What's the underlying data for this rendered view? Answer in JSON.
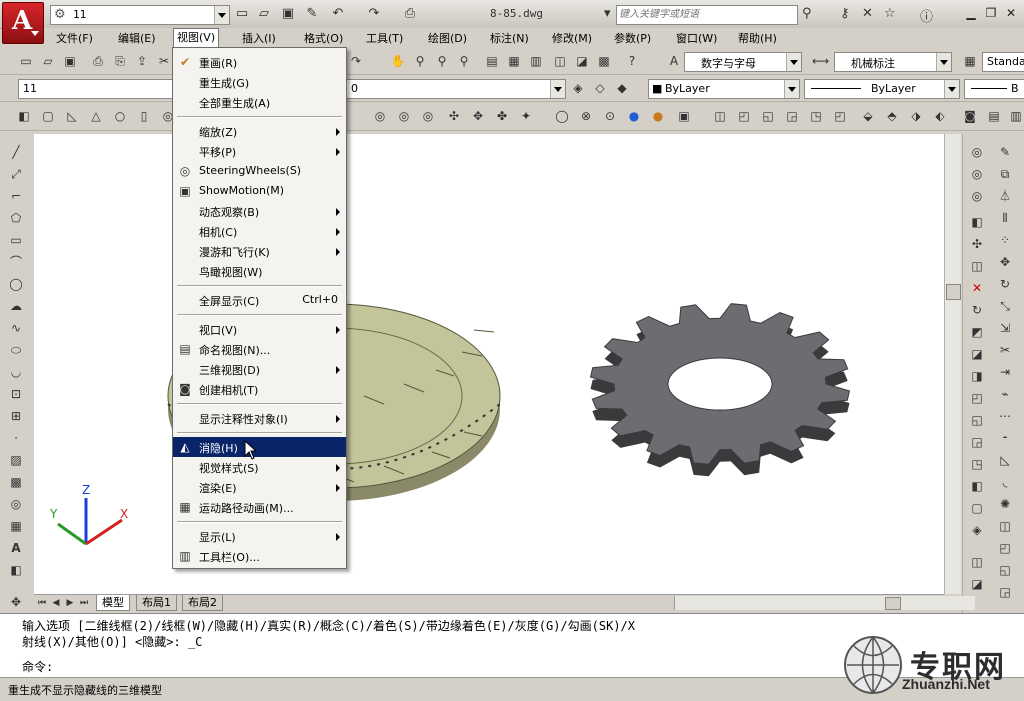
{
  "window": {
    "workspace_value": "11",
    "doc_title": "8-85.dwg",
    "search_placeholder": "键入关键字或短语"
  },
  "menubar": {
    "items": [
      {
        "label": "文件(F)"
      },
      {
        "label": "编辑(E)"
      },
      {
        "label": "视图(V)"
      },
      {
        "label": "插入(I)"
      },
      {
        "label": "格式(O)"
      },
      {
        "label": "工具(T)"
      },
      {
        "label": "绘图(D)"
      },
      {
        "label": "标注(N)"
      },
      {
        "label": "修改(M)"
      },
      {
        "label": "参数(P)"
      },
      {
        "label": "窗口(W)"
      },
      {
        "label": "帮助(H)"
      }
    ]
  },
  "toolbar": {
    "text_style": "数字与字母",
    "dim_style": "机械标注",
    "table_style": "Standa",
    "layer": "11",
    "layer_state": "0",
    "color": "ByLayer",
    "linetype": "ByLayer",
    "lineweight": "B"
  },
  "view_menu": {
    "items": [
      {
        "label": "重画(R)",
        "icon": "brush-icon"
      },
      {
        "label": "重生成(G)"
      },
      {
        "label": "全部重生成(A)"
      },
      {
        "label": "缩放(Z)",
        "submenu": true
      },
      {
        "label": "平移(P)",
        "submenu": true
      },
      {
        "label": "SteeringWheels(S)",
        "icon": "steering-wheel-icon"
      },
      {
        "label": "ShowMotion(M)",
        "icon": "showmotion-icon"
      },
      {
        "label": "动态观察(B)",
        "submenu": true
      },
      {
        "label": "相机(C)",
        "submenu": true
      },
      {
        "label": "漫游和飞行(K)",
        "submenu": true
      },
      {
        "label": "鸟瞰视图(W)"
      },
      {
        "label": "全屏显示(C)",
        "shortcut": "Ctrl+0"
      },
      {
        "label": "视口(V)",
        "submenu": true
      },
      {
        "label": "命名视图(N)...",
        "icon": "named-view-icon"
      },
      {
        "label": "三维视图(D)",
        "submenu": true
      },
      {
        "label": "创建相机(T)",
        "icon": "camera-icon"
      },
      {
        "label": "显示注释性对象(I)",
        "submenu": true
      },
      {
        "label": "消隐(H)",
        "icon": "hide-icon",
        "highlighted": true
      },
      {
        "label": "视觉样式(S)",
        "submenu": true
      },
      {
        "label": "渲染(E)",
        "submenu": true
      },
      {
        "label": "运动路径动画(M)...",
        "icon": "motion-path-icon"
      },
      {
        "label": "显示(L)",
        "submenu": true
      },
      {
        "label": "工具栏(O)...",
        "icon": "toolbar-icon"
      }
    ]
  },
  "ucs": {
    "x": "X",
    "y": "Y",
    "z": "Z"
  },
  "tabs": [
    {
      "label": "模型"
    },
    {
      "label": "布局1"
    },
    {
      "label": "布局2"
    }
  ],
  "command": {
    "line1": "输入选项 [二维线框(2)/线框(W)/隐藏(H)/真实(R)/概念(C)/着色(S)/带边缘着色(E)/灰度(G)/勾画(SK)/X",
    "line2": "射线(X)/其他(O)] <隐藏>: _C",
    "prompt": "命令:"
  },
  "status": {
    "text": "重生成不显示隐藏线的三维模型"
  },
  "watermark": {
    "text": "专职网",
    "url": "Zhuanzhi.Net"
  },
  "colors": {
    "gear": "#6d6d71",
    "gear_edge": "#3a3a3c",
    "disk_fill": "#c4c49a",
    "highlight": "#0a246a"
  }
}
